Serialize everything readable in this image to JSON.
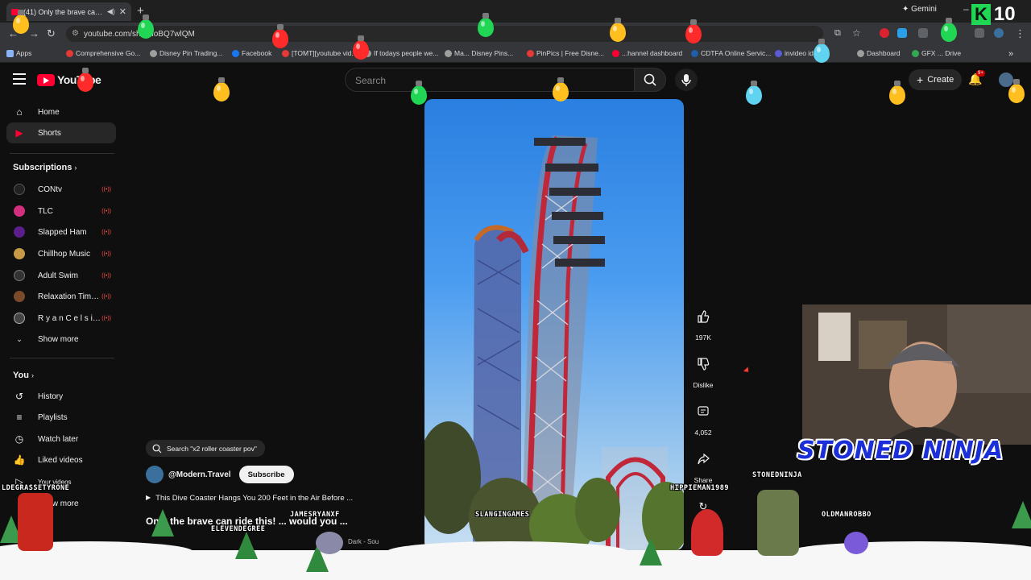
{
  "browser": {
    "tab_title": "(41) Only the brave can rid",
    "url": "youtube.com/sh...0ioBQ7wlQM",
    "gemini_label": "Gemini",
    "bookmarks": [
      "Apps",
      "Comprehensive Go...",
      "Disney Pin Trading...",
      "Facebook",
      "[TOMT][youtube vid...",
      "If todays people we...",
      "Ma... Disney Pins...",
      "PinPics | Free Disne...",
      "...hannel dashboard",
      "CDTFA Online Servic...",
      "invideo id...",
      "Dashboard",
      "GFX ... Drive"
    ]
  },
  "header": {
    "logo_text": "YouTube",
    "search_placeholder": "Search",
    "create_label": "Create",
    "notif_badge": "9+"
  },
  "sidebar": {
    "nav": [
      {
        "label": "Home",
        "icon": "home-icon"
      },
      {
        "label": "Shorts",
        "icon": "shorts-icon"
      }
    ],
    "subscriptions_heading": "Subscriptions",
    "channels": [
      {
        "label": "CONtv",
        "color": "#222222"
      },
      {
        "label": "TLC",
        "color": "#d32f7f"
      },
      {
        "label": "Slapped Ham",
        "color": "#5a1f8a"
      },
      {
        "label": "Chillhop Music",
        "color": "#c79a48"
      },
      {
        "label": "Adult Swim",
        "color": "#333333"
      },
      {
        "label": "Relaxation Time ...",
        "color": "#7a4a2a"
      },
      {
        "label": "R y a n C e l s i u ...",
        "color": "#444444"
      }
    ],
    "show_more": "Show more",
    "you_heading": "You",
    "you_items": [
      {
        "label": "History",
        "icon": "history-icon"
      },
      {
        "label": "Playlists",
        "icon": "playlists-icon"
      },
      {
        "label": "Watch later",
        "icon": "watch-later-icon"
      },
      {
        "label": "Liked videos",
        "icon": "liked-videos-icon"
      },
      {
        "label": "Your videos",
        "icon": "your-videos-icon"
      }
    ],
    "show_more_2": "Show more"
  },
  "short": {
    "search_chip": "Search \"x2 roller coaster pov\"",
    "channel": "@Modern.Travel",
    "subscribe_label": "Subscribe",
    "title": "This Dive Coaster Hangs You 200 Feet in the Air Before ...",
    "description": "Only the brave can ride this! ... would you ...",
    "sub_text": "Dark - Sou"
  },
  "actions": {
    "likes": "197K",
    "dislike": "Dislike",
    "comments": "4,052",
    "share": "Share"
  },
  "overlay": {
    "k_score": "10",
    "cam_title": "STONED NINJA",
    "viewers": [
      "LDEGRASSETYRONE",
      "ELEVENDEGREE",
      "JAMESRYANXF",
      "SLANGINGAMES",
      "HIPPIEMAN1989",
      "STONEDNINJA",
      "OLDMANROBBO"
    ]
  },
  "colors": {
    "accent": "#ff0033",
    "bulb_colors": [
      "#ffbf1f",
      "#ff2a2a",
      "#22d655",
      "#5fd3f0"
    ]
  }
}
